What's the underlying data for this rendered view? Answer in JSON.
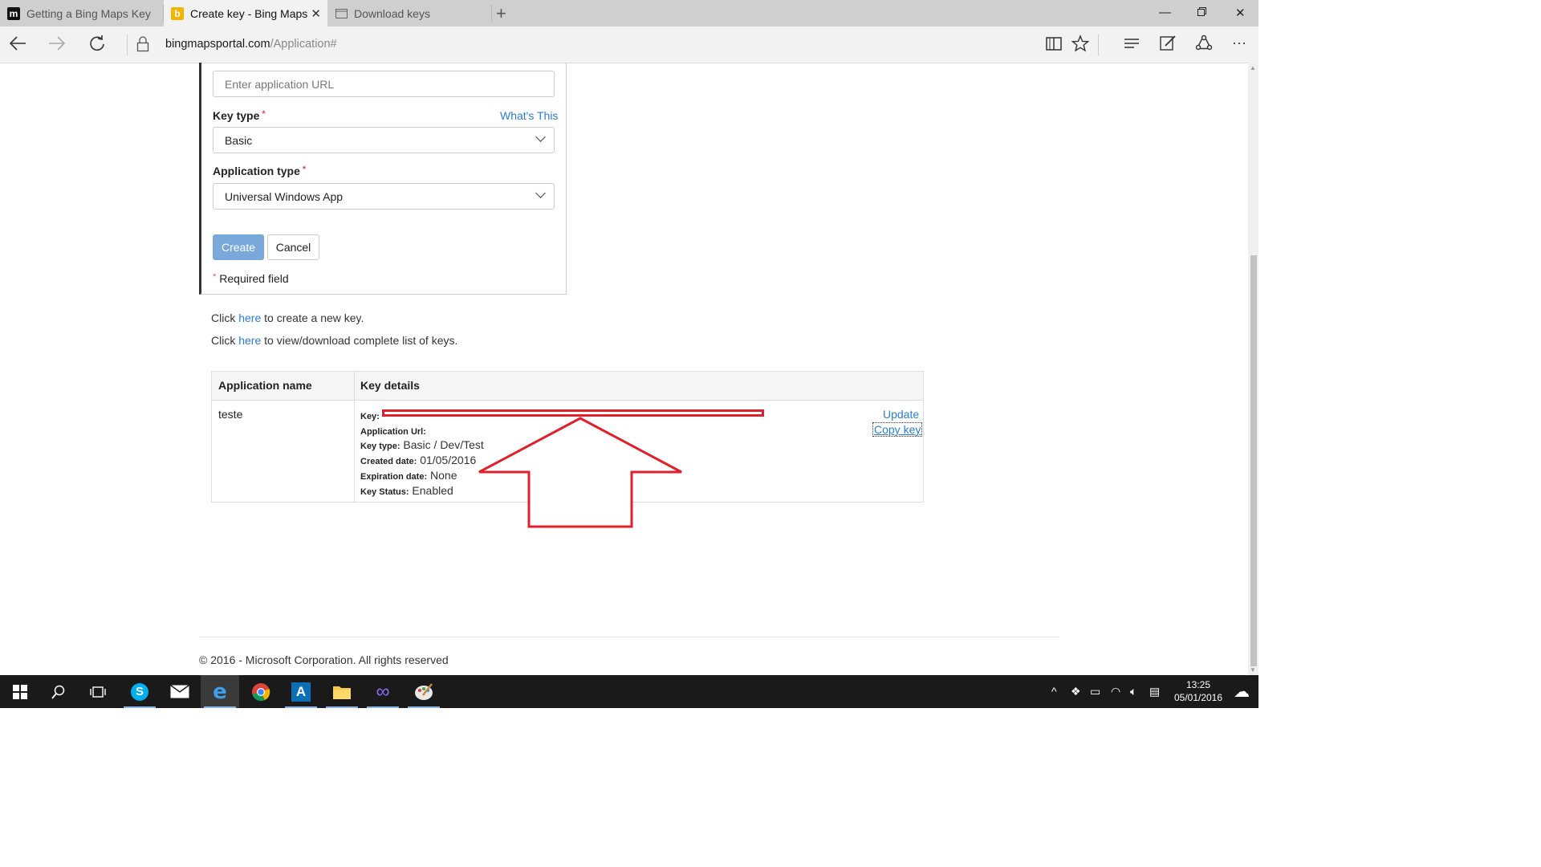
{
  "browser": {
    "tabs": [
      {
        "title": "Getting a Bing Maps Key",
        "favicon": "m-favicon",
        "active": false
      },
      {
        "title": "Create key - Bing Maps",
        "favicon": "bing-favicon",
        "active": true
      },
      {
        "title": "Download keys",
        "favicon": "page-favicon",
        "active": false
      }
    ],
    "url_domain": "bingmapsportal.com",
    "url_path": "/Application#"
  },
  "form": {
    "url_placeholder": "Enter application URL",
    "key_type_label": "Key type",
    "whats_this": "What's This",
    "key_type_value": "Basic",
    "app_type_label": "Application type",
    "app_type_value": "Universal Windows App",
    "required_mark": "*",
    "create_label": "Create",
    "cancel_label": "Cancel",
    "required_note": "Required field"
  },
  "links": {
    "line1_pre": "Click ",
    "line1_link": "here",
    "line1_post": " to create a new key.",
    "line2_pre": "Click ",
    "line2_link": "here",
    "line2_post": " to view/download complete list of keys."
  },
  "keys_table": {
    "headers": {
      "app_name": "Application name",
      "key_details": "Key details"
    },
    "row": {
      "app_name": "teste",
      "key_label": "Key:",
      "app_url_label": "Application Url:",
      "key_type_label": "Key type:",
      "key_type_value": "Basic / Dev/Test",
      "created_label": "Created date:",
      "created_value": "01/05/2016",
      "expiration_label": "Expiration date:",
      "expiration_value": "None",
      "status_label": "Key Status:",
      "status_value": "Enabled",
      "update_label": "Update",
      "copy_label": "Copy key"
    }
  },
  "footer": {
    "copyright": "© 2016 - Microsoft Corporation. All rights reserved"
  },
  "taskbar": {
    "time": "13:25",
    "date": "05/01/2016"
  },
  "colors": {
    "link": "#2b7cd3",
    "highlight": "#e0202b",
    "create_button": "#79a9da"
  }
}
